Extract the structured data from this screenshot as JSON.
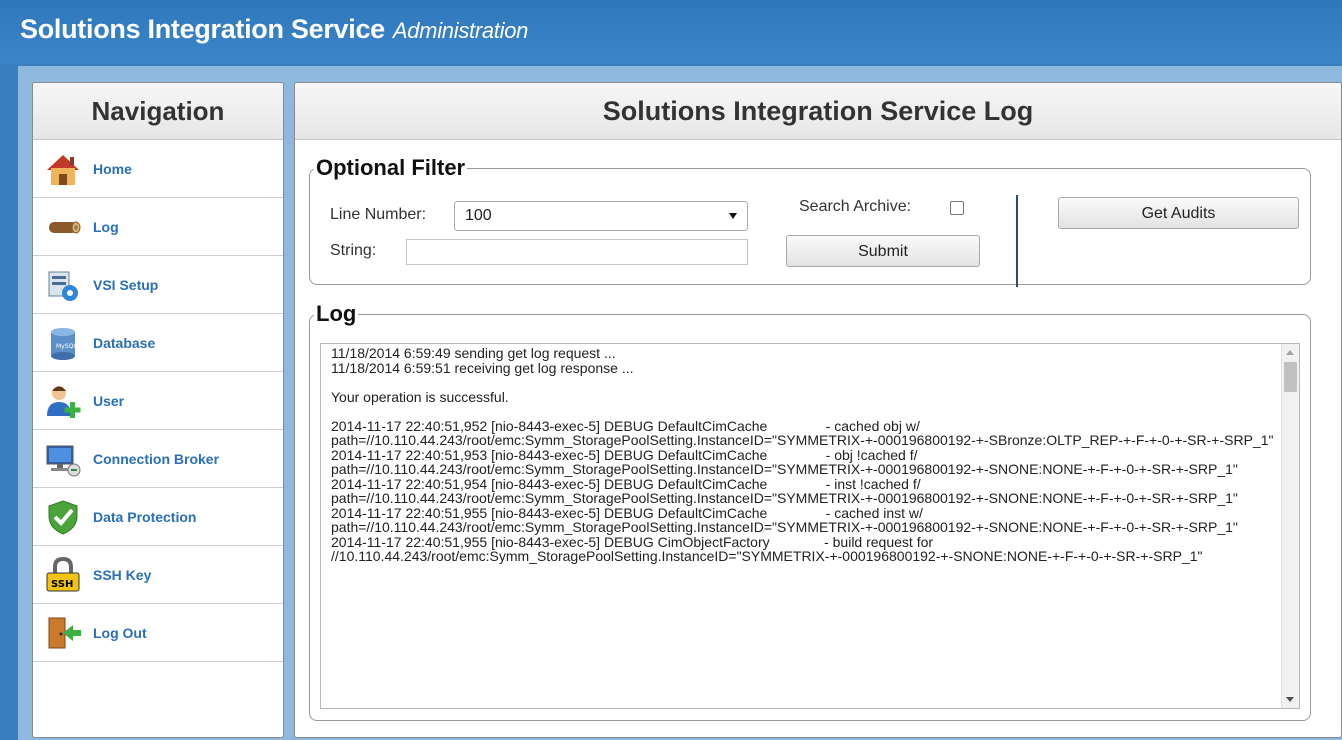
{
  "app": {
    "title": "Solutions Integration Service",
    "subtitle": "Administration"
  },
  "navigation": {
    "title": "Navigation",
    "items": [
      {
        "label": "Home",
        "icon": "house-icon"
      },
      {
        "label": "Log",
        "icon": "log-icon"
      },
      {
        "label": "VSI Setup",
        "icon": "vsi-setup-icon"
      },
      {
        "label": "Database",
        "icon": "database-icon"
      },
      {
        "label": "User",
        "icon": "user-add-icon"
      },
      {
        "label": "Connection Broker",
        "icon": "connection-broker-icon"
      },
      {
        "label": "Data Protection",
        "icon": "shield-check-icon"
      },
      {
        "label": "SSH Key",
        "icon": "ssh-lock-icon"
      },
      {
        "label": "Log Out",
        "icon": "logout-door-icon"
      }
    ]
  },
  "main": {
    "title": "Solutions Integration Service Log",
    "filter": {
      "legend": "Optional Filter",
      "line_number_label": "Line Number:",
      "line_number_value": "100",
      "string_label": "String:",
      "string_value": "",
      "search_archive_label": "Search Archive:",
      "search_archive_checked": false,
      "submit_label": "Submit",
      "get_audits_label": "Get Audits"
    },
    "log": {
      "legend": "Log",
      "content": "11/18/2014 6:59:49 sending get log request ...\n11/18/2014 6:59:51 receiving get log response ...\n\nYour operation is successful.\n\n2014-11-17 22:40:51,952 [nio-8443-exec-5] DEBUG DefaultCimCache               - cached obj w/\npath=//10.110.44.243/root/emc:Symm_StoragePoolSetting.InstanceID=\"SYMMETRIX-+-000196800192-+-SBronze:OLTP_REP-+-F-+-0-+-SR-+-SRP_1\"\n2014-11-17 22:40:51,953 [nio-8443-exec-5] DEBUG DefaultCimCache               - obj !cached f/\npath=//10.110.44.243/root/emc:Symm_StoragePoolSetting.InstanceID=\"SYMMETRIX-+-000196800192-+-SNONE:NONE-+-F-+-0-+-SR-+-SRP_1\"\n2014-11-17 22:40:51,954 [nio-8443-exec-5] DEBUG DefaultCimCache               - inst !cached f/\npath=//10.110.44.243/root/emc:Symm_StoragePoolSetting.InstanceID=\"SYMMETRIX-+-000196800192-+-SNONE:NONE-+-F-+-0-+-SR-+-SRP_1\"\n2014-11-17 22:40:51,955 [nio-8443-exec-5] DEBUG DefaultCimCache               - cached inst w/\npath=//10.110.44.243/root/emc:Symm_StoragePoolSetting.InstanceID=\"SYMMETRIX-+-000196800192-+-SNONE:NONE-+-F-+-0-+-SR-+-SRP_1\"\n2014-11-17 22:40:51,955 [nio-8443-exec-5] DEBUG CimObjectFactory              - build request for\n//10.110.44.243/root/emc:Symm_StoragePoolSetting.InstanceID=\"SYMMETRIX-+-000196800192-+-SNONE:NONE-+-F-+-0-+-SR-+-SRP_1\""
    }
  },
  "colors": {
    "header_blue": "#3b86c8",
    "nav_link": "#2a6fb7"
  }
}
